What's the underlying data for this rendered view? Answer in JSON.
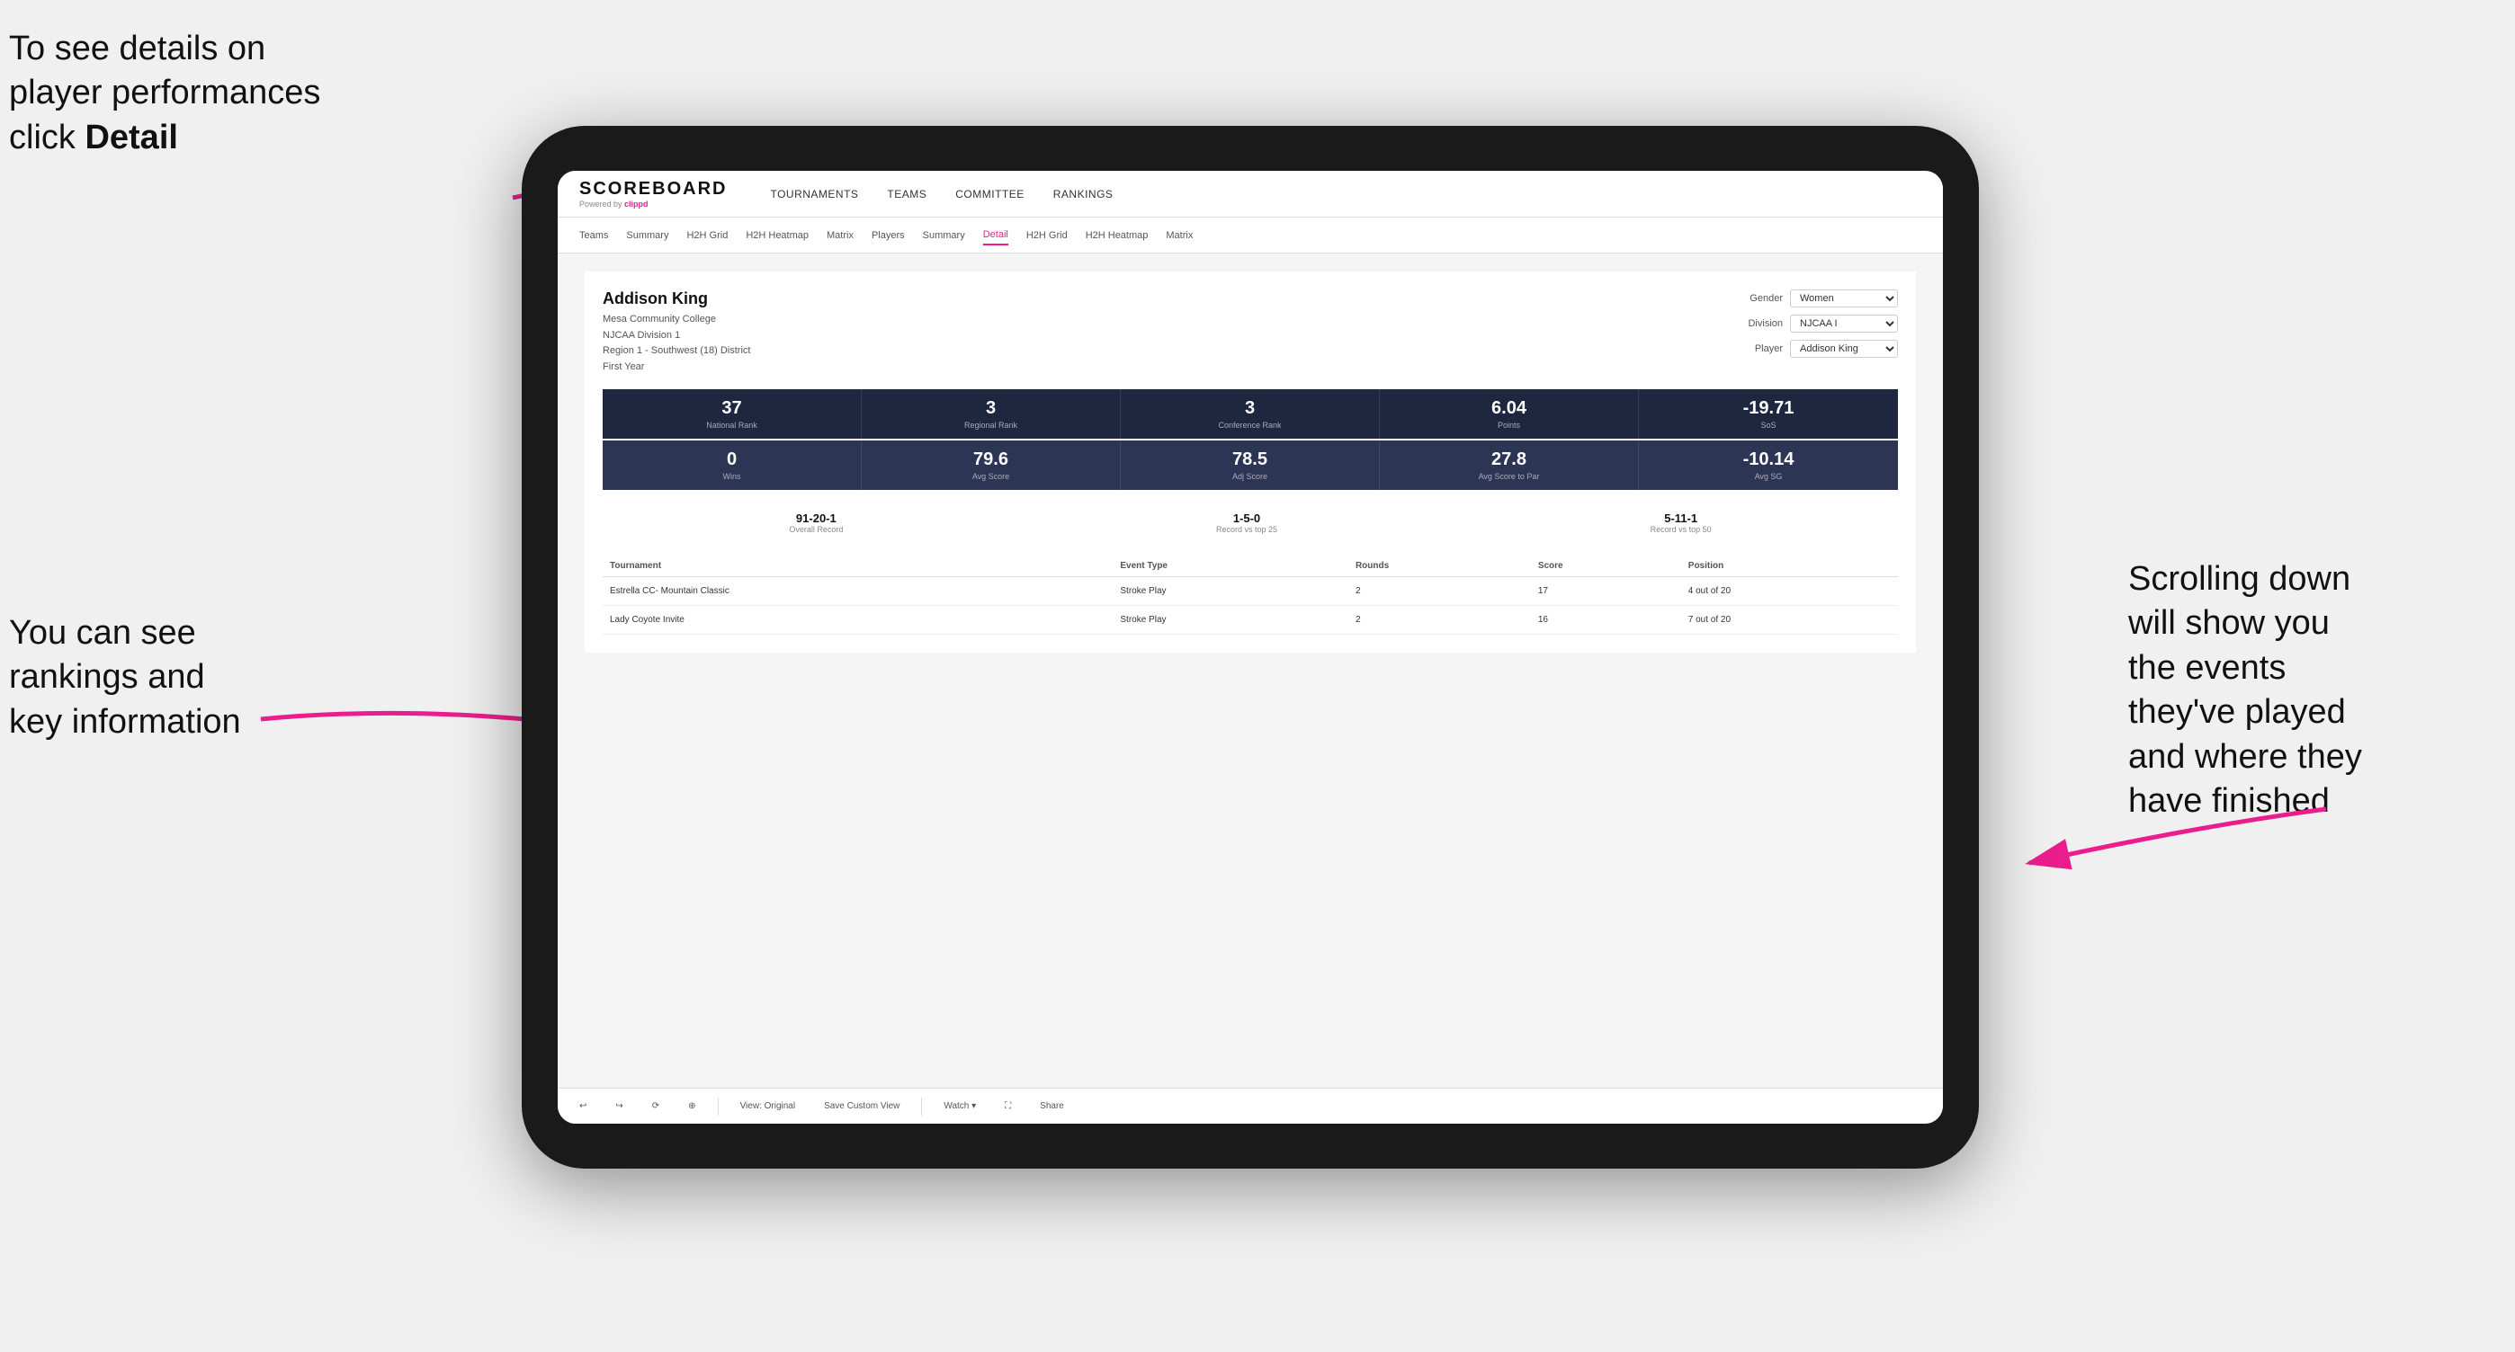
{
  "annotations": {
    "topleft": {
      "line1": "To see details on",
      "line2": "player performances",
      "line3": "click ",
      "line3bold": "Detail"
    },
    "bottomleft": {
      "line1": "You can see",
      "line2": "rankings and",
      "line3": "key information"
    },
    "bottomright": {
      "line1": "Scrolling down",
      "line2": "will show you",
      "line3": "the events",
      "line4": "they've played",
      "line5": "and where they",
      "line6": "have finished"
    }
  },
  "nav": {
    "logo": "SCOREBOARD",
    "powered_by": "Powered by ",
    "clippd": "clippd",
    "items": [
      "TOURNAMENTS",
      "TEAMS",
      "COMMITTEE",
      "RANKINGS"
    ]
  },
  "sub_nav": {
    "items": [
      "Teams",
      "Summary",
      "H2H Grid",
      "H2H Heatmap",
      "Matrix",
      "Players",
      "Summary",
      "Detail",
      "H2H Grid",
      "H2H Heatmap",
      "Matrix"
    ]
  },
  "player": {
    "name": "Addison King",
    "college": "Mesa Community College",
    "division": "NJCAA Division 1",
    "region": "Region 1 - Southwest (18) District",
    "year": "First Year",
    "gender_label": "Gender",
    "gender_value": "Women",
    "division_label": "Division",
    "division_value": "NJCAA I",
    "player_label": "Player",
    "player_value": "Addison King"
  },
  "stats_row1": [
    {
      "value": "37",
      "label": "National Rank"
    },
    {
      "value": "3",
      "label": "Regional Rank"
    },
    {
      "value": "3",
      "label": "Conference Rank"
    },
    {
      "value": "6.04",
      "label": "Points"
    },
    {
      "value": "-19.71",
      "label": "SoS"
    }
  ],
  "stats_row2": [
    {
      "value": "0",
      "label": "Wins"
    },
    {
      "value": "79.6",
      "label": "Avg Score"
    },
    {
      "value": "78.5",
      "label": "Adj Score"
    },
    {
      "value": "27.8",
      "label": "Avg Score to Par"
    },
    {
      "value": "-10.14",
      "label": "Avg SG"
    }
  ],
  "records": [
    {
      "value": "91-20-1",
      "label": "Overall Record"
    },
    {
      "value": "1-5-0",
      "label": "Record vs top 25"
    },
    {
      "value": "5-11-1",
      "label": "Record vs top 50"
    }
  ],
  "table": {
    "headers": [
      "Tournament",
      "Event Type",
      "Rounds",
      "Score",
      "Position"
    ],
    "rows": [
      {
        "tournament": "Estrella CC- Mountain Classic",
        "event_type": "Stroke Play",
        "rounds": "2",
        "score": "17",
        "position": "4 out of 20"
      },
      {
        "tournament": "Lady Coyote Invite",
        "event_type": "Stroke Play",
        "rounds": "2",
        "score": "16",
        "position": "7 out of 20"
      }
    ]
  },
  "toolbar": {
    "buttons": [
      "View: Original",
      "Save Custom View",
      "Watch ▾",
      "Share"
    ]
  }
}
